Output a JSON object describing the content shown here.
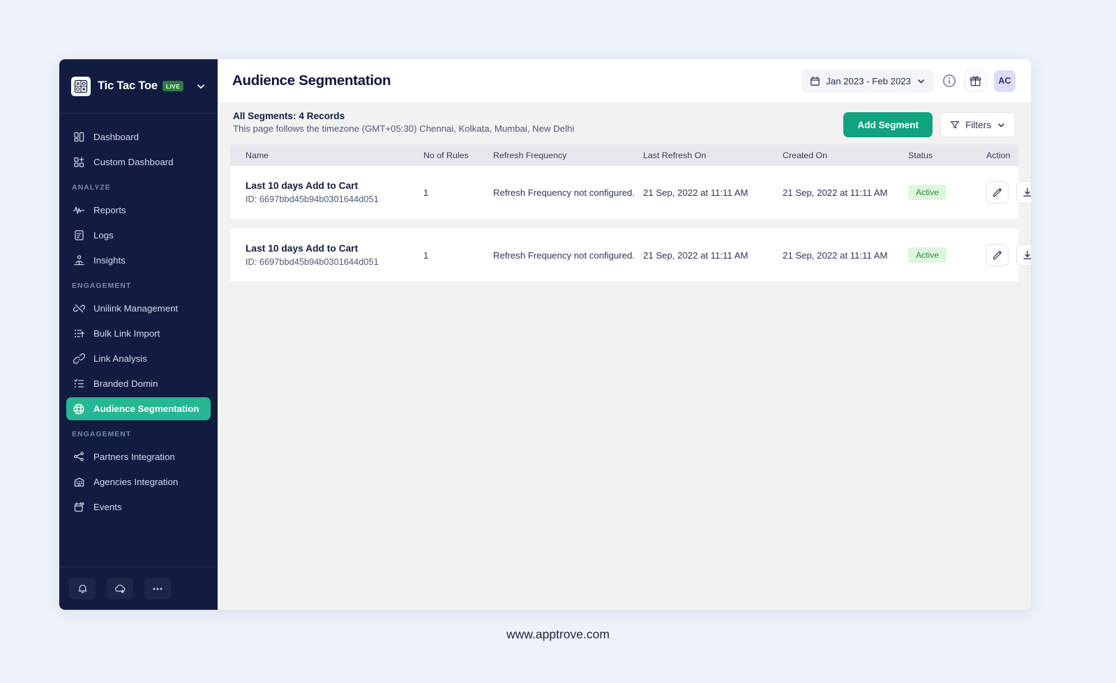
{
  "sidebar": {
    "brand": {
      "name": "Tic Tac Toe",
      "badge": "LIVE",
      "logo_icon": "tic-tac-toe-logo",
      "caret_icon": "chevron-down-icon"
    },
    "items": [
      {
        "label": "Dashboard",
        "icon": "dashboard-icon",
        "type": "item",
        "active": false
      },
      {
        "label": "Custom Dashboard",
        "icon": "custom-dashboard-icon",
        "type": "item",
        "active": false
      },
      {
        "label": "ANALYZE",
        "type": "section"
      },
      {
        "label": "Reports",
        "icon": "pulse-icon",
        "type": "item",
        "active": false
      },
      {
        "label": "Logs",
        "icon": "document-icon",
        "type": "item",
        "active": false
      },
      {
        "label": "Insights",
        "icon": "insights-icon",
        "type": "item",
        "active": false
      },
      {
        "label": "ENGAGEMENT",
        "type": "section"
      },
      {
        "label": "Unilink Management",
        "icon": "unlink-icon",
        "type": "item",
        "active": false
      },
      {
        "label": "Bulk Link Import",
        "icon": "bulk-import-icon",
        "type": "item",
        "active": false
      },
      {
        "label": "Link Analysis",
        "icon": "link-icon",
        "type": "item",
        "active": false
      },
      {
        "label": "Branded Domin",
        "icon": "list-check-icon",
        "type": "item",
        "active": false
      },
      {
        "label": "Audience Segmentation",
        "icon": "globe-icon",
        "type": "item",
        "active": true
      },
      {
        "label": "ENGAGEMENT",
        "type": "section"
      },
      {
        "label": "Partners Integration",
        "icon": "share-nodes-icon",
        "type": "item",
        "active": false
      },
      {
        "label": "Agencies Integration",
        "icon": "building-icon",
        "type": "item",
        "active": false
      },
      {
        "label": "Events",
        "icon": "calendar-event-icon",
        "type": "item",
        "active": false
      }
    ],
    "footer_buttons": [
      {
        "icon": "bell-icon",
        "name": "notifications-button"
      },
      {
        "icon": "cloud-download-icon",
        "name": "cloud-download-button"
      },
      {
        "icon": "ellipsis-icon",
        "name": "more-options-button"
      }
    ],
    "active_color": "#25b792"
  },
  "header": {
    "title": "Audience Segmentation",
    "date_range": "Jan 2023 - Feb 2023",
    "calendar_icon": "calendar-icon",
    "date_caret_icon": "chevron-down-icon",
    "info_icon": "info-icon",
    "gift_icon": "gift-icon",
    "avatar_initials": "AC"
  },
  "listbar": {
    "records_title": "All Segments: 4 Records",
    "timezone_note": "This page follows the timezone (GMT+05:30) Chennai, Kolkata, Mumbai, New Delhi",
    "add_segment_label": "Add Segment",
    "filters_label": "Filters",
    "filter_icon": "funnel-icon",
    "filter_caret_icon": "chevron-down-icon",
    "primary_color": "#11a37f"
  },
  "table": {
    "columns": [
      "Name",
      "No of Rules",
      "Refresh Frequency",
      "Last Refresh On",
      "Created On",
      "Status",
      "Action"
    ],
    "rows": [
      {
        "name": "Last 10 days Add to Cart",
        "id": "ID: 6697bbd45b94b0301644d051",
        "rules": "1",
        "refresh_frequency": "Refresh Frequency not configured.",
        "last_refresh_on": "21 Sep, 2022 at 11:11 AM",
        "created_on": "21 Sep, 2022 at 11:11 AM",
        "status": "Active",
        "edit_icon": "edit-icon",
        "download_icon": "download-icon"
      },
      {
        "name": "Last 10 days Add to Cart",
        "id": "ID: 6697bbd45b94b0301644d051",
        "rules": "1",
        "refresh_frequency": "Refresh Frequency not configured.",
        "last_refresh_on": "21 Sep, 2022 at 11:11 AM",
        "created_on": "21 Sep, 2022 at 11:11 AM",
        "status": "Active",
        "edit_icon": "edit-icon",
        "download_icon": "download-icon"
      }
    ],
    "status_color": "#2c8a3a"
  },
  "footer": {
    "url": "www.apptrove.com"
  }
}
